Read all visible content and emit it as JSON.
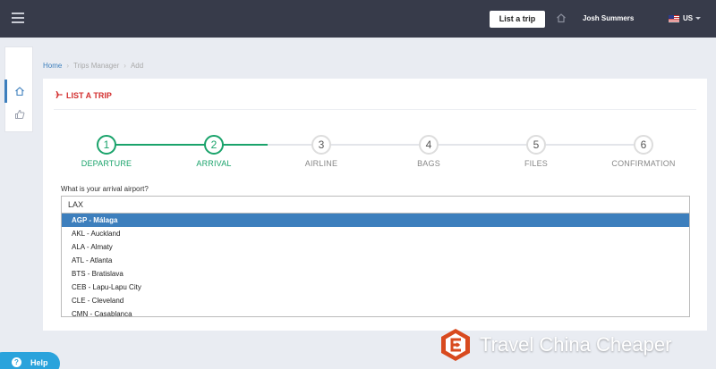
{
  "topbar": {
    "list_trip_label": "List a trip",
    "user_name": "Josh Summers",
    "language": "US"
  },
  "breadcrumb": [
    {
      "label": "Home"
    },
    {
      "label": "Trips Manager"
    },
    {
      "label": "Add"
    }
  ],
  "card": {
    "title": "LIST A TRIP",
    "accent_color": "#d32f2f"
  },
  "stepper": {
    "done_color": "#1aa36b",
    "steps": [
      {
        "number": "1",
        "label": "DEPARTURE",
        "completed": true
      },
      {
        "number": "2",
        "label": "ARRIVAL",
        "completed": true
      },
      {
        "number": "3",
        "label": "AIRLINE",
        "completed": false
      },
      {
        "number": "4",
        "label": "BAGS",
        "completed": false
      },
      {
        "number": "5",
        "label": "FILES",
        "completed": false
      },
      {
        "number": "6",
        "label": "CONFIRMATION",
        "completed": false
      }
    ]
  },
  "form": {
    "question": "What is your arrival airport?",
    "input_value": "LAX",
    "options": [
      "AGP - Málaga",
      "AKL - Auckland",
      "ALA - Almaty",
      "ATL - Atlanta",
      "BTS - Bratislava",
      "CEB - Lapu-Lapu City",
      "CLE - Cleveland",
      "CMN - Casablanca"
    ],
    "selected_option": "AGP - Málaga",
    "selected_color": "#3d7fbd"
  },
  "help": {
    "icon_text": "?",
    "label": "Help"
  },
  "watermark": {
    "text": "Travel China Cheaper"
  },
  "icons": {
    "menu": "hamburger-icon",
    "home": "home-icon",
    "like": "thumbs-up-icon",
    "plane": "plane-icon",
    "flag": "us-flag-icon"
  }
}
